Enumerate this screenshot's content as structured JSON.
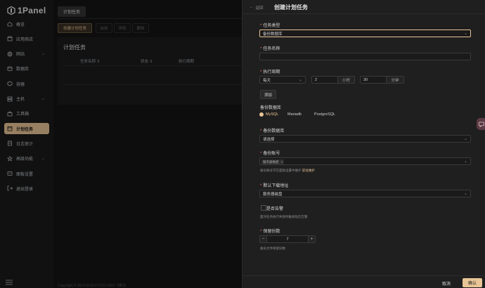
{
  "app": {
    "name": "1Panel"
  },
  "sidebar": {
    "items": [
      {
        "label": "概览",
        "icon": "home-icon"
      },
      {
        "label": "应用商店",
        "icon": "store-icon"
      },
      {
        "label": "网站",
        "icon": "globe-icon",
        "expandable": true
      },
      {
        "label": "数据库",
        "icon": "database-icon"
      },
      {
        "label": "容器",
        "icon": "container-icon"
      },
      {
        "label": "主机",
        "icon": "server-icon",
        "expandable": true
      },
      {
        "label": "工具箱",
        "icon": "toolbox-icon"
      },
      {
        "label": "计划任务",
        "icon": "calendar-icon",
        "active": true
      },
      {
        "label": "日志审计",
        "icon": "log-icon"
      },
      {
        "label": "高级功能",
        "icon": "star-icon",
        "expandable": true
      },
      {
        "label": "面板设置",
        "icon": "settings-icon"
      },
      {
        "label": "退出登录",
        "icon": "logout-icon"
      }
    ]
  },
  "main": {
    "tab": "计划任务",
    "create_button": "创建计划任务",
    "enable_button": "启用",
    "disable_button": "停用",
    "delete_button": "删除",
    "panel_title": "计划任务",
    "columns": [
      "任务名称",
      "状态",
      "执行周期"
    ],
    "copyright": "Copyright © 2014-2025 FIT2CLOUD 飞致云"
  },
  "drawer": {
    "back_label": "返回",
    "title": "创建计划任务",
    "task_type": {
      "label": "任务类型",
      "value": "备份数据库"
    },
    "task_name": {
      "label": "任务名称",
      "value": ""
    },
    "cycle": {
      "label": "执行周期",
      "period": "每天",
      "hour": "2",
      "hour_unit": "小时",
      "minute": "30",
      "minute_unit": "分钟",
      "add_button": "添加"
    },
    "backup_db": {
      "label": "备份数据库",
      "options": [
        "MySQL",
        "Mariadb",
        "PostgreSQL"
      ],
      "selected": "MySQL"
    },
    "backup_target": {
      "label": "备份数据库",
      "placeholder": "请选择"
    },
    "backup_account": {
      "label": "备份账号",
      "tag": "服务器磁盘",
      "help": "备份账号可在面板设置中维护 ",
      "help_link": "前往维护"
    },
    "download_addr": {
      "label": "默认下载地址",
      "value": "服务器磁盘"
    },
    "alert": {
      "label": "是否告警",
      "help": "面对任务执行失败时触发短信告警"
    },
    "retain": {
      "label": "保留份数",
      "value": "7",
      "help": "备份文件保留份数"
    },
    "cancel_button": "取消",
    "confirm_button": "确认"
  },
  "colors": {
    "accent": "#e8c496",
    "danger": "#f56c6c",
    "background": "#141414",
    "drawer": "#1f1f1f"
  }
}
